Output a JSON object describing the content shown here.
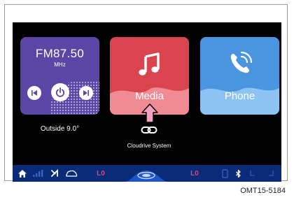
{
  "radio": {
    "frequency": "FM87.50",
    "unit": "MHz",
    "controls": [
      "previous-icon",
      "power-icon",
      "next-icon"
    ]
  },
  "media": {
    "label": "Media",
    "icon": "music-note-icon"
  },
  "phone": {
    "label": "Phone",
    "icon": "phone-icon"
  },
  "outside": {
    "label": "Outside 9.0°"
  },
  "cloudrive": {
    "label": "Cloudrive System",
    "icon": "link-icon"
  },
  "statusbar": {
    "left_temp": "L0",
    "right_temp": "L0",
    "icons": [
      "home-icon",
      "signal-icon",
      "fan-icon",
      "car-icon",
      "center-dial-icon",
      "phone-status-icon",
      "bluetooth-icon",
      "seat-heat-left-icon",
      "seat-heat-right-icon"
    ]
  },
  "caption": "OMT15-5184",
  "colors": {
    "radio_tile": "#5b46a6",
    "media_tile": "#d9444f",
    "phone_tile": "#4a95df",
    "statusbar": "#0a2c78",
    "temp_text": "#e0457a",
    "pointer": "#f3a0c0"
  }
}
